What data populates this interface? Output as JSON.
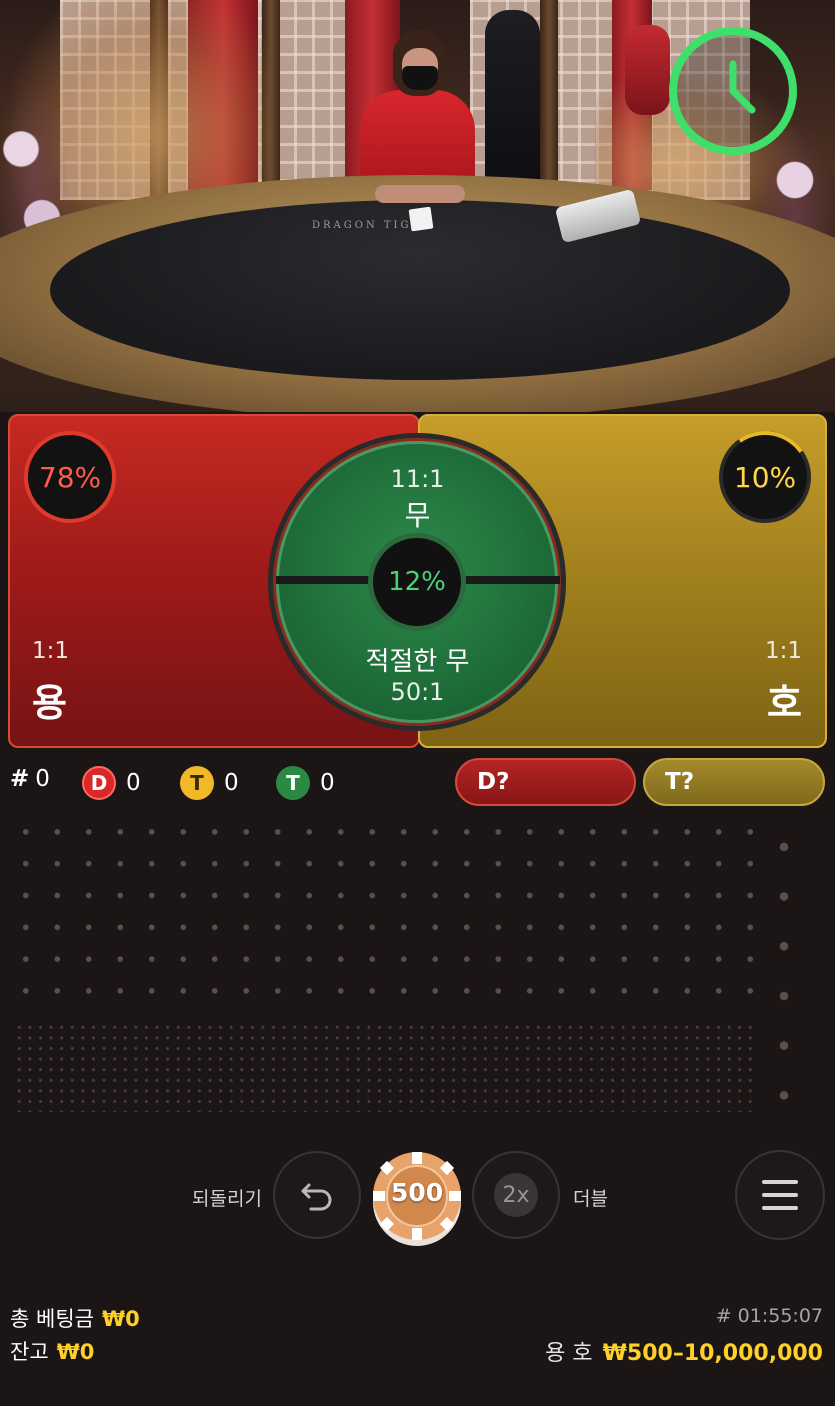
{
  "video": {
    "table_print": "DRAGON   TIGER",
    "timer_icon": "clock-icon"
  },
  "board": {
    "dragon": {
      "percent": "78%",
      "odds": "1:1",
      "label": "용"
    },
    "tiger": {
      "percent": "10%",
      "odds": "1:1",
      "label": "호"
    },
    "tie": {
      "odds": "11:1",
      "label": "무",
      "percent": "12%"
    },
    "suited_tie": {
      "label": "적절한 무",
      "odds": "50:1"
    }
  },
  "stats": {
    "rounds": {
      "symbol": "#",
      "count": "0"
    },
    "dragon": {
      "badge": "D",
      "count": "0"
    },
    "tiger": {
      "badge": "T",
      "count": "0"
    },
    "tie": {
      "badge": "T",
      "count": "0"
    }
  },
  "predictions": {
    "dragon": "D?",
    "tiger": "T?"
  },
  "controls": {
    "undo_label": "되돌리기",
    "double_label": "더블",
    "double_icon_text": "2x",
    "chip_value": "500",
    "menu_icon": "hamburger-menu-icon"
  },
  "footer": {
    "total_bet_label": "총 베팅금",
    "total_bet_value": "₩0",
    "balance_label": "잔고",
    "balance_value": "₩0",
    "round_id": "# 01:55:07",
    "limits_label": "용 호",
    "limits_value": "₩500–10,000,000"
  },
  "colors": {
    "dragon": "#c62a22",
    "tiger": "#c59d2a",
    "tie": "#1f6e3a",
    "money": "#ffd028",
    "timer": "#3ee06a"
  }
}
